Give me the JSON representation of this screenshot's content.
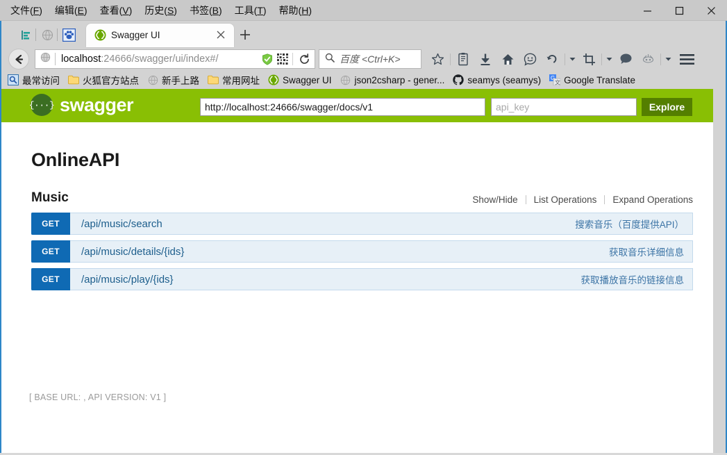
{
  "window": {
    "menus": [
      {
        "label": "文件",
        "mnemonic": "F"
      },
      {
        "label": "编辑",
        "mnemonic": "E"
      },
      {
        "label": "查看",
        "mnemonic": "V"
      },
      {
        "label": "历史",
        "mnemonic": "S"
      },
      {
        "label": "书签",
        "mnemonic": "B"
      },
      {
        "label": "工具",
        "mnemonic": "T"
      },
      {
        "label": "帮助",
        "mnemonic": "H"
      }
    ],
    "controls": {
      "minimize": "minimize-button",
      "maximize": "maximize-button",
      "close": "close-button"
    }
  },
  "browser": {
    "tab": {
      "title": "Swagger UI",
      "favicon": "swagger-favicon",
      "close": "close-tab-icon"
    },
    "new_tab": "+",
    "tab_tools": [
      "sidebar-icon",
      "globe-icon",
      "paw-icon"
    ],
    "nav": {
      "back": "back-arrow-icon",
      "url_host": "localhost",
      "url_rest": ":24666/swagger/ui/index#/",
      "url_full": "localhost:24666/swagger/ui/index#/",
      "identity_icon": "shield-icon",
      "qr_icon": "qr-code-icon",
      "reload_icon": "reload-icon"
    },
    "search": {
      "placeholder": "百度 <Ctrl+K>",
      "icon": "search-icon"
    },
    "toolbar_icons": [
      "bookmark-star-icon",
      "reader-mode-icon",
      "download-arrow-icon",
      "home-icon",
      "smiley-icon",
      "undo-icon",
      "crop-icon",
      "speech-bubble-icon",
      "extension-icon",
      "hamburger-menu-icon"
    ],
    "bookmarks": [
      {
        "label": "最常访问",
        "icon": "most-visited-icon"
      },
      {
        "label": "火狐官方站点",
        "icon": "folder-icon"
      },
      {
        "label": "新手上路",
        "icon": "globe-icon"
      },
      {
        "label": "常用网址",
        "icon": "folder-icon"
      },
      {
        "label": "Swagger UI",
        "icon": "swagger-favicon"
      },
      {
        "label": "json2csharp - gener...",
        "icon": "globe-icon"
      },
      {
        "label": "seamys (seamys)",
        "icon": "github-icon"
      },
      {
        "label": "Google Translate",
        "icon": "google-translate-icon"
      }
    ]
  },
  "swagger": {
    "brand": "swagger",
    "logo_glyph": "{···}",
    "spec_url": "http://localhost:24666/swagger/docs/v1",
    "api_key_placeholder": "api_key",
    "explore_label": "Explore",
    "header_color": "#89bf04",
    "explore_color": "#547f00"
  },
  "api": {
    "title": "OnlineAPI",
    "resource": "Music",
    "options": [
      "Show/Hide",
      "List Operations",
      "Expand Operations"
    ],
    "operations": [
      {
        "method": "GET",
        "path": "/api/music/search",
        "description": "搜索音乐（百度提供API）",
        "method_color": "#0f6ab4"
      },
      {
        "method": "GET",
        "path": "/api/music/details/{ids}",
        "description": "获取音乐详细信息",
        "method_color": "#0f6ab4"
      },
      {
        "method": "GET",
        "path": "/api/music/play/{ids}",
        "description": "获取播放音乐的链接信息",
        "method_color": "#0f6ab4"
      }
    ],
    "footer": "[ BASE URL: , API VERSION: V1 ]"
  }
}
